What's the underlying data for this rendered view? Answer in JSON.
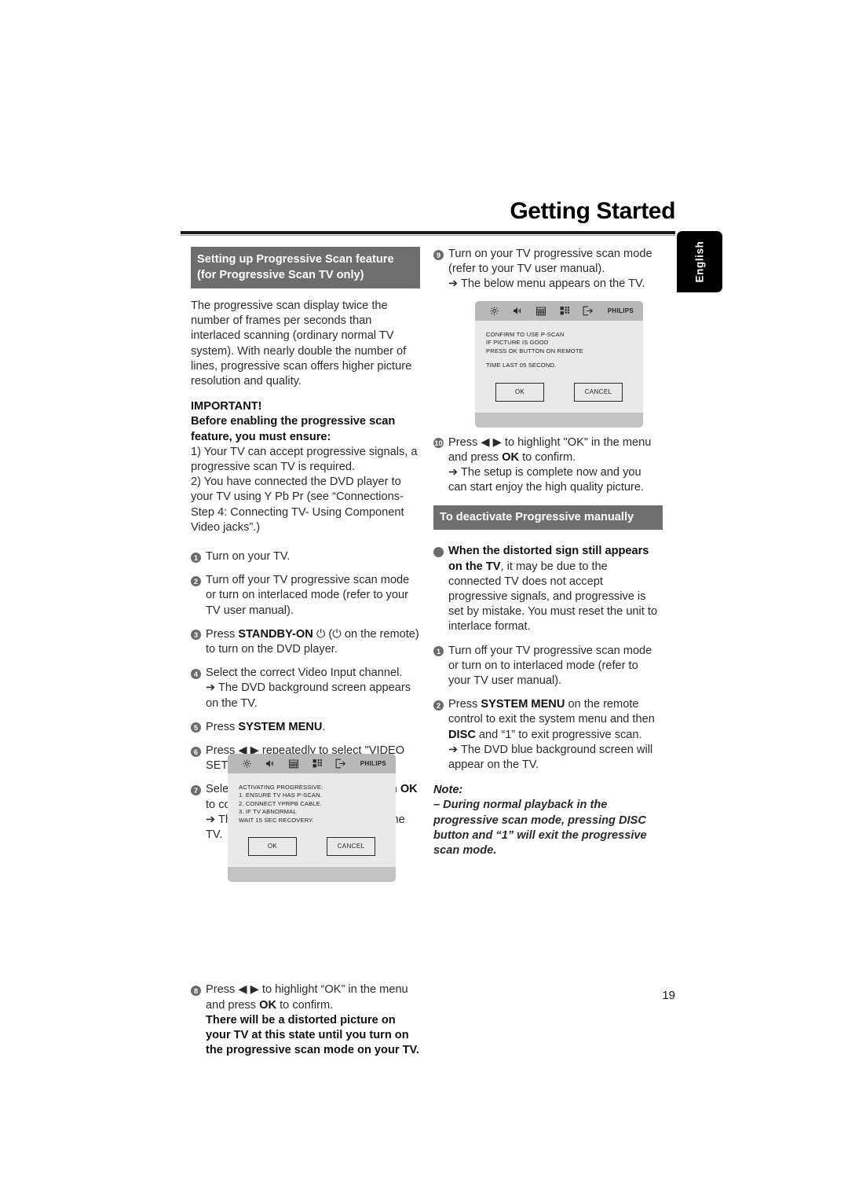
{
  "header": {
    "title": "Getting Started",
    "language_tab": "English"
  },
  "page_number": "19",
  "left_column": {
    "section_heading": "Setting up Progressive Scan feature (for Progressive Scan TV only)",
    "intro": "The progressive scan display twice the number of frames per seconds than interlaced scanning (ordinary normal TV system). With nearly double the number of lines, progressive scan offers higher picture resolution and quality.",
    "important_label": "IMPORTANT!",
    "important_lead": "Before enabling the progressive scan feature, you must ensure:",
    "ensure_1": "1) Your TV can accept progressive signals, a progressive scan TV is required.",
    "ensure_2": "2) You have connected the DVD player to your TV using Y Pb Pr (see “Connections-Step 4: Connecting TV- Using Component Video jacks”.)",
    "steps": [
      {
        "num": "1",
        "text": "Turn on your TV."
      },
      {
        "num": "2",
        "text": "Turn off your TV progressive scan mode or turn on interlaced mode (refer to your TV user manual)."
      },
      {
        "num": "3",
        "text_before": "Press ",
        "bold1": "STANDBY-ON",
        "text_mid": " ⏻ (⏻  on the remote) to turn on the DVD player."
      },
      {
        "num": "4",
        "text": "Select the correct Video Input channel.",
        "result": "➔ The DVD background screen appears on the TV."
      },
      {
        "num": "5",
        "text_before": "Press ",
        "bold1": "SYSTEM MENU",
        "text_mid": "."
      },
      {
        "num": "6",
        "text": "Press ◀ ▶ repeatedly to select \"VIDEO SETUP PAGE\"."
      },
      {
        "num": "7",
        "text_before": "Select \"TV MODE\" to \"P-SCAN\", then ",
        "bold1": "OK",
        "text_mid": " to confirm.",
        "result": "➔ The instruction menu appears on the TV."
      },
      {
        "num": "8",
        "text_before": "Press ◀ ▶ to highlight “OK” in the menu and press ",
        "bold1": "OK",
        "text_mid": " to confirm."
      }
    ],
    "warning_bold": "There will be a distorted picture on your TV at this state until you turn on the progressive scan mode on your TV."
  },
  "right_column": {
    "steps": [
      {
        "num": "9",
        "text": "Turn on your TV progressive scan mode (refer to your TV user manual).",
        "result": "➔ The below menu appears on the TV."
      },
      {
        "num": "10",
        "text_before": "Press ◀ ▶ to highlight \"OK\" in the menu and press ",
        "bold1": "OK",
        "text_mid": " to confirm.",
        "result": "➔ The setup is complete now and you can start enjoy the high quality picture."
      }
    ],
    "section_heading": "To deactivate Progressive manually",
    "bullet_bold": "When the distorted sign still appears on the TV",
    "bullet_rest": ", it may be due to the connected TV does not accept progressive signals, and progressive is set by mistake. You must reset the unit to interlace format.",
    "deact_steps": [
      {
        "num": "1",
        "text": "Turn off your TV progressive scan mode or turn on to interlaced mode (refer to your TV user manual)."
      },
      {
        "num": "2",
        "text_before": "Press ",
        "bold1": "SYSTEM MENU",
        "text_mid": " on the remote control to exit the system menu and then ",
        "bold2": "DISC",
        "text_end": " and “1” to exit progressive scan.",
        "result": "➔ The DVD blue background screen will appear on the TV."
      }
    ],
    "note_title": "Note:",
    "note_body": "–  During normal playback in the progressive scan mode, pressing DISC button and “1” will exit the progressive scan mode."
  },
  "tv_screen_left": {
    "brand": "PHILIPS",
    "icons": [
      "gear-icon",
      "speaker-icon",
      "display-icon",
      "preferences-grid-icon",
      "exit-arrow-icon"
    ],
    "lines": [
      "ACTIVATING PROGRESSIVE:",
      "1. ENSURE TV HAS P-SCAN.",
      "2. CONNECT YPRPB CABLE.",
      "3. IF TV ABNORMAL",
      "WAIT 15 SEC RECOVERY."
    ],
    "lines2": [],
    "ok_label": "OK",
    "cancel_label": "CANCEL"
  },
  "tv_screen_right": {
    "brand": "PHILIPS",
    "icons": [
      "gear-icon",
      "speaker-icon",
      "display-icon",
      "preferences-grid-icon",
      "exit-arrow-icon"
    ],
    "lines": [
      "CONFIRM TO USE P-SCAN",
      "IF PICTURE IS GOOD",
      "PRESS OK BUTTON ON REMOTE"
    ],
    "lines2": [
      "TIME LAST 05 SECOND."
    ],
    "ok_label": "OK",
    "cancel_label": "CANCEL"
  }
}
